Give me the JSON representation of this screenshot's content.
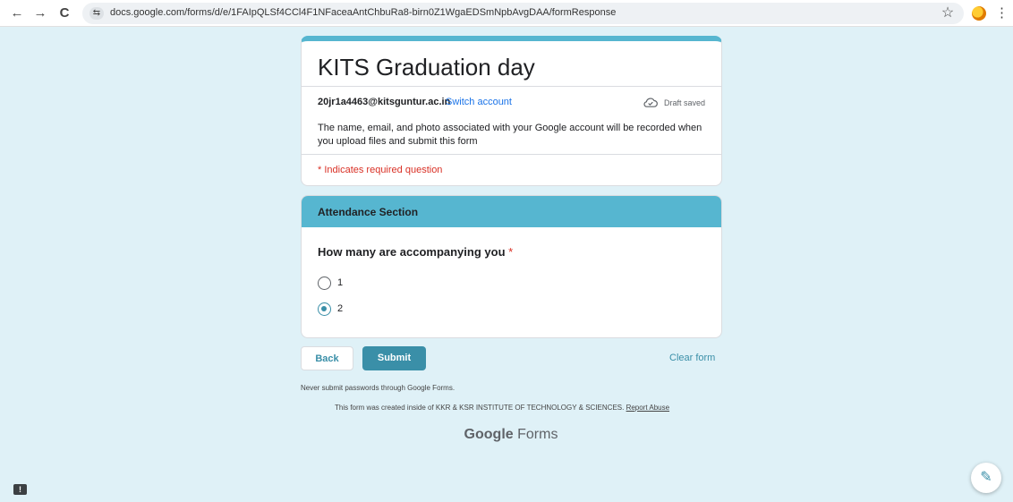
{
  "browser": {
    "back_glyph": "←",
    "forward_glyph": "→",
    "reload_glyph": "C",
    "site_info_glyph": "⇆",
    "url": "docs.google.com/forms/d/e/1FAIpQLSf4CCl4F1NFaceaAntChbuRa8-birn0Z1WgaEDSmNpbAvgDAA/formResponse",
    "star_glyph": "☆",
    "menu_glyph": "⋮"
  },
  "form": {
    "title": "KITS Graduation day",
    "account_email": "20jr1a4463@kitsguntur.ac.in",
    "switch_account": "Switch account",
    "draft_status": "Draft saved",
    "privacy_text": "The name, email, and photo associated with your Google account will be recorded when you upload files and submit this form",
    "required_note": "* Indicates required question"
  },
  "section": {
    "title": "Attendance Section",
    "question": "How many are accompanying you",
    "required_marker": "*",
    "options": [
      {
        "label": "1",
        "selected": false
      },
      {
        "label": "2",
        "selected": true
      }
    ]
  },
  "actions": {
    "back_label": "Back",
    "submit_label": "Submit",
    "clear_label": "Clear form"
  },
  "footer": {
    "password_warning": "Never submit passwords through Google Forms.",
    "created_text": "This form was created inside of KKR & KSR INSTITUTE OF TECHNOLOGY & SCIENCES.",
    "report_abuse": "Report Abuse",
    "brand_google": "Google",
    "brand_forms": "Forms"
  },
  "floating": {
    "feedback_glyph": "!",
    "edit_glyph": "✎"
  },
  "colors": {
    "accent": "#3a8fa8",
    "header": "#56b6d0",
    "background": "#dff1f7",
    "required": "#d93025",
    "link": "#1a73e8"
  }
}
